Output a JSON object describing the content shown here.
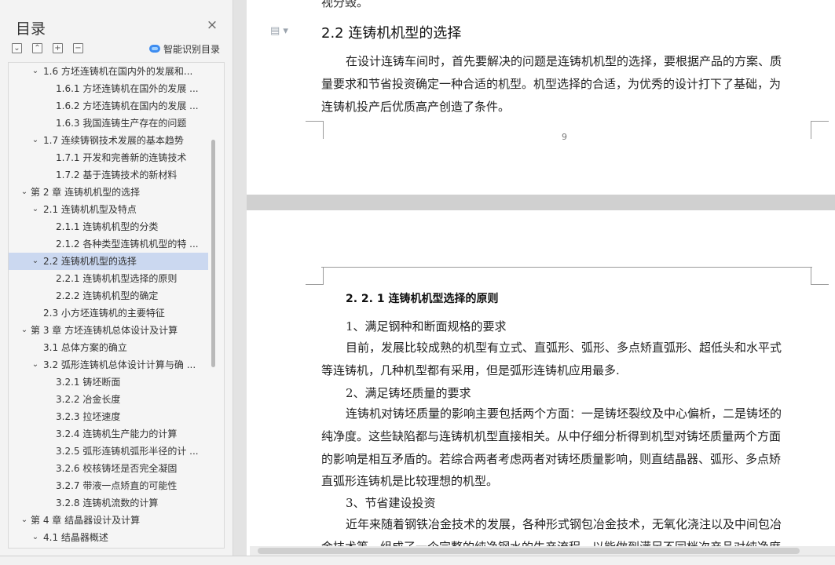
{
  "nav": {
    "title": "目录",
    "close_icon": "close-icon",
    "tools": [
      "expand-all-icon",
      "collapse-all-icon",
      "add-heading-icon",
      "remove-heading-icon"
    ],
    "tool_glyphs": [
      "⌄",
      "⌃",
      "+",
      "−"
    ],
    "smart_toc_label": "智能识别目录",
    "toc": [
      {
        "level": 1,
        "arrow": "⌄",
        "label": "1.6   方坯连铸机在国内外的发展和..."
      },
      {
        "level": 2,
        "arrow": "",
        "label": "1.6.1  方坯连铸机在国外的发展 ..."
      },
      {
        "level": 2,
        "arrow": "",
        "label": "1.6.2  方坯连铸机在国内的发展 ..."
      },
      {
        "level": 2,
        "arrow": "",
        "label": "1.6.3  我国连铸生产存在的问题"
      },
      {
        "level": 1,
        "arrow": "⌄",
        "label": "1.7   连续铸钢技术发展的基本趋势"
      },
      {
        "level": 2,
        "arrow": "",
        "label": "1.7.1  开发和完善新的连铸技术"
      },
      {
        "level": 2,
        "arrow": "",
        "label": "1.7.2  基于连铸技术的新材料"
      },
      {
        "level": 0,
        "arrow": "⌄",
        "label": "第 2 章   连铸机机型的选择"
      },
      {
        "level": 1,
        "arrow": "⌄",
        "label": "2.1   连铸机机型及特点"
      },
      {
        "level": 2,
        "arrow": "",
        "label": "2.1.1  连铸机机型的分类"
      },
      {
        "level": 2,
        "arrow": "",
        "label": "2.1.2  各种类型连铸机机型的特 ..."
      },
      {
        "level": 1,
        "arrow": "⌄",
        "label": "2.2   连铸机机型的选择",
        "selected": true
      },
      {
        "level": 2,
        "arrow": "",
        "label": "2.2.1  连铸机机型选择的原则"
      },
      {
        "level": 2,
        "arrow": "",
        "label": "2.2.2  连铸机机型的确定"
      },
      {
        "level": 1,
        "arrow": "",
        "label": "2.3   小方坯连铸机的主要特征"
      },
      {
        "level": 0,
        "arrow": "⌄",
        "label": "第 3 章   方坯连铸机总体设计及计算"
      },
      {
        "level": 1,
        "arrow": "",
        "label": "3.1   总体方案的确立"
      },
      {
        "level": 1,
        "arrow": "⌄",
        "label": "3.2   弧形连铸机总体设计计算与确 ..."
      },
      {
        "level": 2,
        "arrow": "",
        "label": "3.2.1  铸坯断面"
      },
      {
        "level": 2,
        "arrow": "",
        "label": "3.2.2  冶金长度"
      },
      {
        "level": 2,
        "arrow": "",
        "label": "3.2.3  拉坯速度"
      },
      {
        "level": 2,
        "arrow": "",
        "label": "3.2.4  连铸机生产能力的计算"
      },
      {
        "level": 2,
        "arrow": "",
        "label": "3.2.5  弧形连铸机弧形半径的计 ..."
      },
      {
        "level": 2,
        "arrow": "",
        "label": "3.2.6  校核铸坯是否完全凝固"
      },
      {
        "level": 2,
        "arrow": "",
        "label": "3.2.7  带液一点矫直的可能性"
      },
      {
        "level": 2,
        "arrow": "",
        "label": "3.2.8  连铸机流数的计算"
      },
      {
        "level": 0,
        "arrow": "⌄",
        "label": "第 4 章   结晶器设计及计算"
      },
      {
        "level": 1,
        "arrow": "⌄",
        "label": "4.1   结晶器概述"
      }
    ]
  },
  "doc": {
    "menu_icon": "document-menu-icon",
    "menu_glyph": "▤ ▾",
    "top_cut_text": "视分毁。",
    "heading_2_2": "2.2   连铸机机型的选择",
    "para_intro_1": "在设计连铸车间时，首先要解决的问题是连铸机机型的选择，要根据产品的方案、质",
    "para_intro_2": "量要求和节省投资确定一种合适的机型。机型选择的合适，为优秀的设计打下了基础，为",
    "para_intro_3": "连铸机投产后优质高产创造了条件。",
    "page_number": "9",
    "heading_2_2_1": "2. 2. 1  连铸机机型选择的原则",
    "item1": "1、满足钢种和断面规格的要求",
    "p1_l1": "目前，发展比较成熟的机型有立式、直弧形、弧形、多点矫直弧形、超低头和水平式",
    "p1_l2": "等连铸机，几种机型都有采用，但是弧形连铸机应用最多.",
    "item2": "2、满足铸坯质量的要求",
    "p2_l1": "连铸机对铸坯质量的影响主要包括两个方面：一是铸坯裂纹及中心偏析，二是铸坯的",
    "p2_l2": "纯净度。这些缺陷都与连铸机机型直接相关。从中仔细分析得到机型对铸坯质量两个方面",
    "p2_l3": "的影响是相互矛盾的。若综合两者考虑两者对铸坯质量影响，则直结晶器、弧形、多点矫",
    "p2_l4": "直弧形连铸机是比较理想的机型。",
    "item3": "3、节省建设投资",
    "p3_l1": "近年来随着钢铁冶金技术的发展，各种形式钢包冶金技术，无氧化浇注以及中间包冶",
    "p3_l2": "金技术等，组成了一个完整的纯净钢水的生产流程，以能做到满足不同档次产品对纯净度"
  }
}
